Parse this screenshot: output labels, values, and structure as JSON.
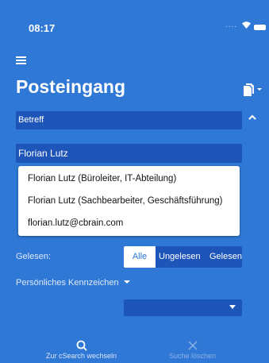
{
  "status_bar": {
    "time": "08:17",
    "signal": "...."
  },
  "header": {
    "title": "Posteingang"
  },
  "subject_field": {
    "label": "Betreff"
  },
  "name_field": {
    "value": "Florian Lutz"
  },
  "suggestions": [
    "Florian Lutz (Büroleiter, IT-Abteilung)",
    "Florian Lutz (Sachbearbeiter, Geschäftsführung)",
    "florian.lutz@cbrain.com"
  ],
  "read_filter": {
    "label": "Gelesen:",
    "options": [
      "Alle",
      "Ungelesen",
      "Gelesen"
    ],
    "selected": "Alle"
  },
  "personal_marker": {
    "label": "Persönliches Kennzeichen",
    "value": ""
  },
  "bottom_bar": {
    "csearch_label": "Zur cSearch wechseln",
    "clear_label": "Suche löschen"
  },
  "colors": {
    "background": "#2f78d6",
    "field": "#1e55b8",
    "text": "#ffffff"
  }
}
